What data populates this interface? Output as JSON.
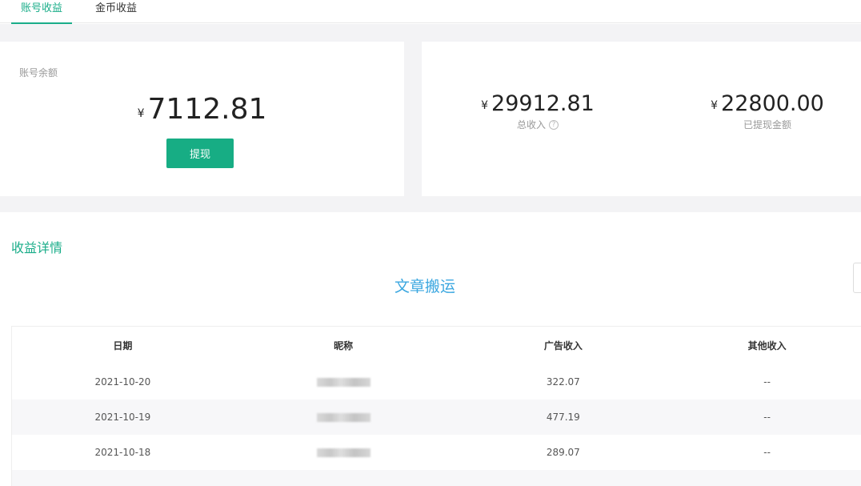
{
  "tabs": [
    {
      "label": "账号收益",
      "active": true
    },
    {
      "label": "金币收益",
      "active": false
    }
  ],
  "balance_card": {
    "label": "账号余额",
    "currency": "¥",
    "amount": "7112.81",
    "withdraw_label": "提现"
  },
  "stats": [
    {
      "currency": "¥",
      "amount": "29912.81",
      "label": "总收入",
      "help_icon": "?"
    },
    {
      "currency": "¥",
      "amount": "22800.00",
      "label": "已提现金额"
    }
  ],
  "details": {
    "title": "收益详情",
    "category": "文章搬运",
    "columns": [
      "日期",
      "昵称",
      "广告收入",
      "其他收入"
    ],
    "rows": [
      {
        "date": "2021-10-20",
        "ad_income": "322.07",
        "other_income": "--"
      },
      {
        "date": "2021-10-19",
        "ad_income": "477.19",
        "other_income": "--"
      },
      {
        "date": "2021-10-18",
        "ad_income": "289.07",
        "other_income": "--"
      }
    ]
  },
  "colors": {
    "accent": "#1aad89",
    "button": "#17ad84",
    "link_blue": "#3ba7e0",
    "page_gray": "#f3f3f5"
  }
}
